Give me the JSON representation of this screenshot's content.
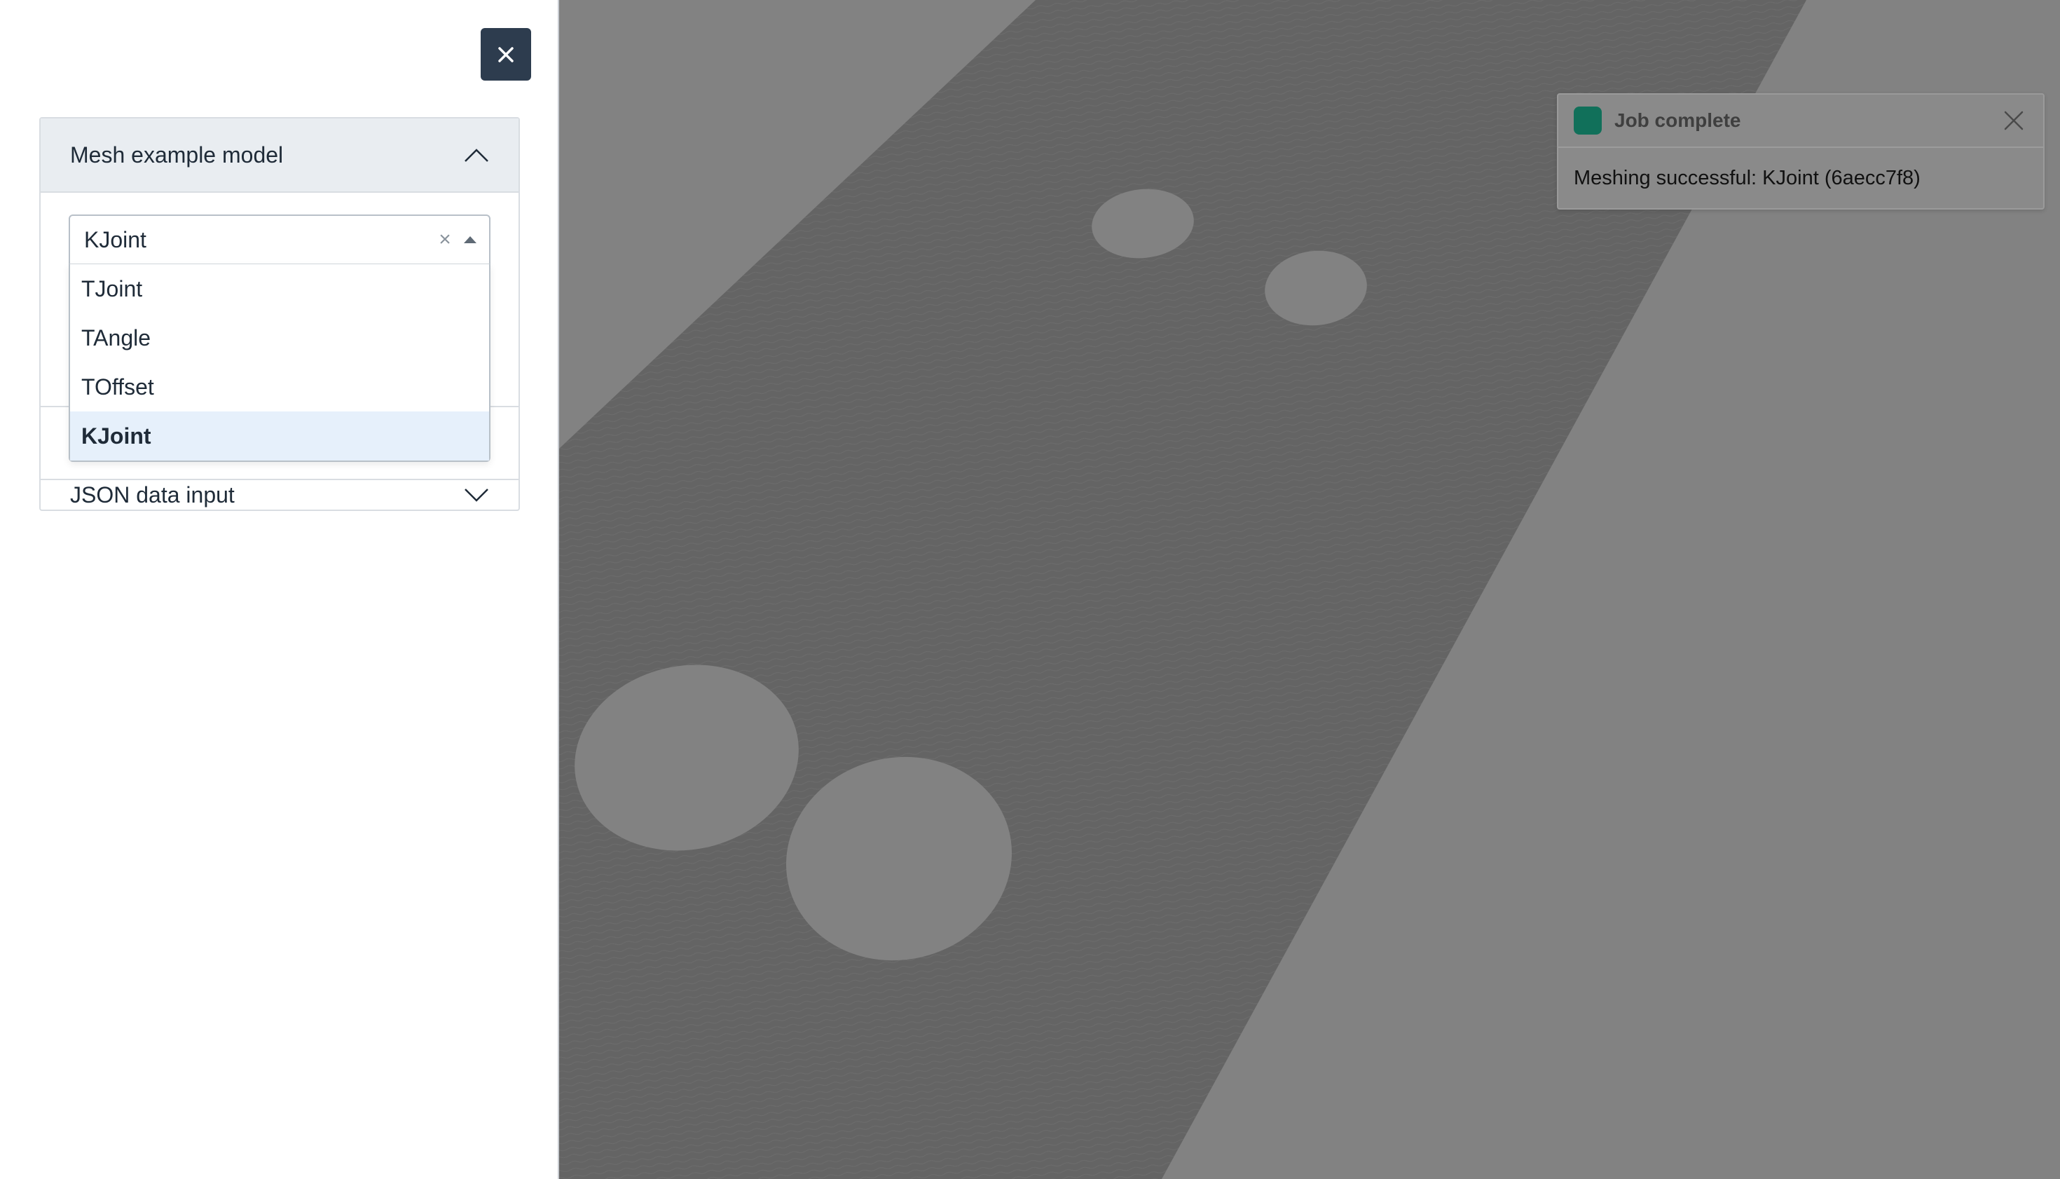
{
  "panel": {
    "close_icon": "close-icon",
    "accordion": {
      "title": "Mesh example model",
      "json_section_title": "JSON data input"
    },
    "select": {
      "value": "KJoint",
      "clear_glyph": "×",
      "options": [
        "TJoint",
        "TAngle",
        "TOffset",
        "KJoint"
      ],
      "selected_index": 3
    }
  },
  "toast": {
    "title": "Job complete",
    "message": "Meshing successful: KJoint (6aecc7f8)",
    "status_color": "#11705a"
  },
  "viewport": {
    "background_color": "#828282",
    "mesh_color": "#646464"
  }
}
